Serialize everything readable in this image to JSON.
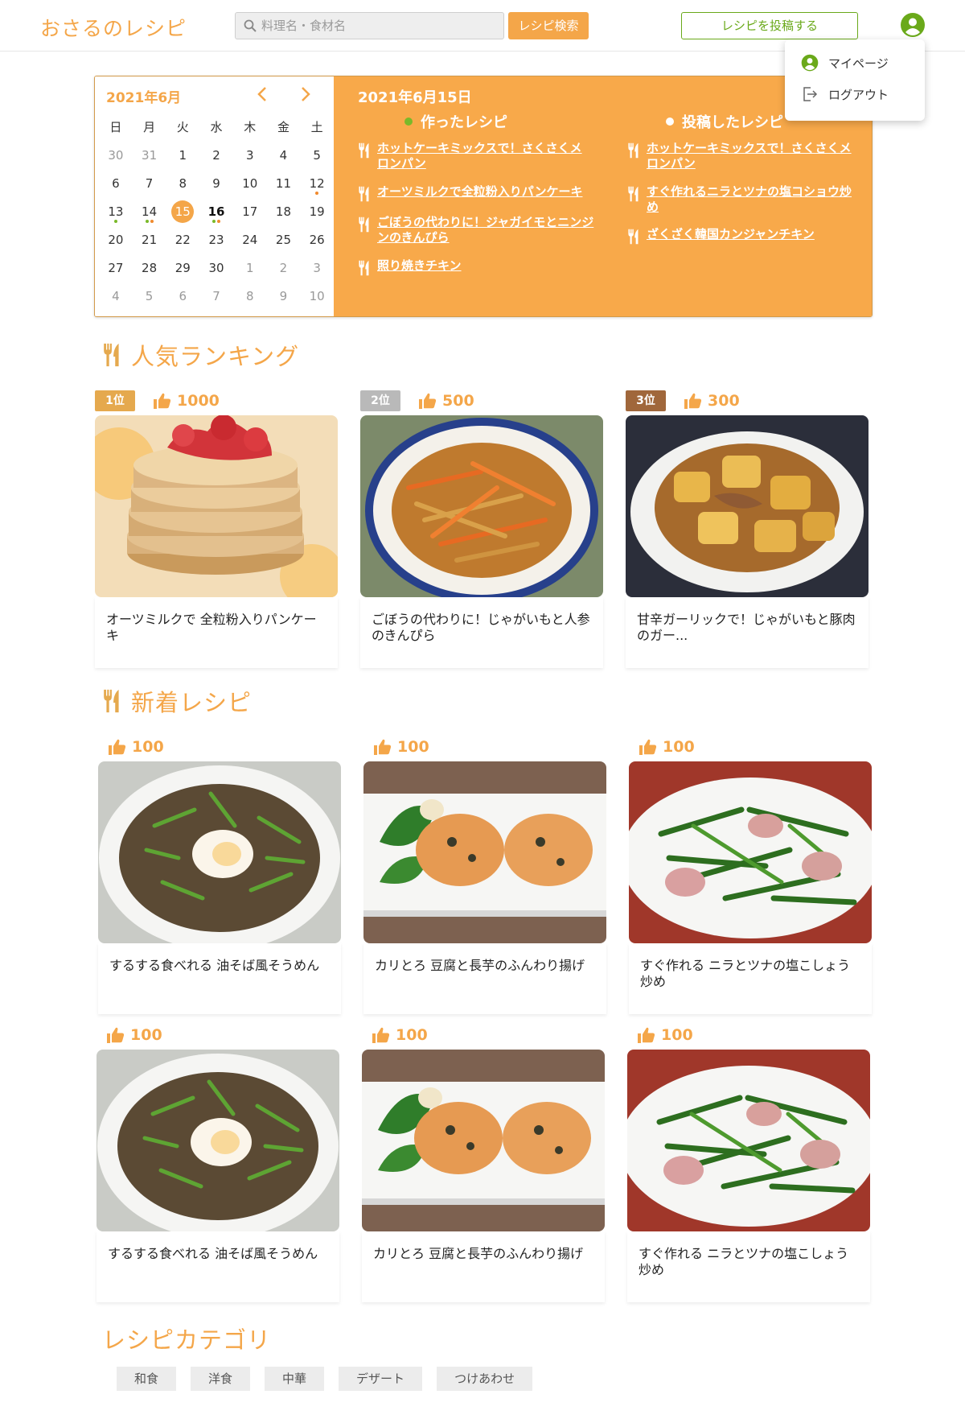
{
  "header": {
    "logo": "おさるのレシピ",
    "search_placeholder": "料理名・食材名",
    "search_button": "レシピ検索",
    "post_button": "レシピを投稿する",
    "avatar_icon": "user-circle-icon"
  },
  "dropdown": {
    "items": [
      {
        "label": "マイページ",
        "icon": "user-circle-icon"
      },
      {
        "label": "ログアウト",
        "icon": "logout-icon"
      }
    ]
  },
  "calendar": {
    "title": "2021年6月",
    "weekdays": [
      "日",
      "月",
      "火",
      "水",
      "木",
      "金",
      "土"
    ],
    "weeks": [
      [
        "30",
        "31",
        "1",
        "2",
        "3",
        "4",
        "5"
      ],
      [
        "6",
        "7",
        "8",
        "9",
        "10",
        "11",
        "12"
      ],
      [
        "13",
        "14",
        "15",
        "16",
        "17",
        "18",
        "19"
      ],
      [
        "20",
        "21",
        "22",
        "23",
        "24",
        "25",
        "26"
      ],
      [
        "27",
        "28",
        "29",
        "30",
        "1",
        "2",
        "3"
      ],
      [
        "4",
        "5",
        "6",
        "7",
        "8",
        "9",
        "10"
      ]
    ],
    "selected_day": "15",
    "bold_day": "16"
  },
  "day_panel": {
    "date": "2021年6月15日",
    "made_heading": "作ったレシピ",
    "posted_heading": "投稿したレシピ",
    "made_recipes": [
      "ホットケーキミックスで！さくさくメロンパン",
      "オーツミルクで全粒粉入りパンケーキ",
      "ごぼうの代わりに！ジャガイモとニンジンのきんぴら",
      "照り焼きチキン"
    ],
    "posted_recipes": [
      "ホットケーキミックスで！さくさくメロンパン",
      "すぐ作れるニラとツナの塩コショウ炒め",
      "ざくざく韓国カンジャンチキン"
    ],
    "made_color": "#7ab929",
    "posted_color": "#ffffff"
  },
  "ranking": {
    "title": "人気ランキング",
    "items": [
      {
        "rank": "1位",
        "likes": "1000",
        "name": "オーツミルクで 全粒粉入りパンケーキ",
        "badge_color": "#e5a94e"
      },
      {
        "rank": "2位",
        "likes": "500",
        "name": "ごぼうの代わりに！じゃがいもと人参のきんぴら",
        "badge_color": "#b9b9b9"
      },
      {
        "rank": "3位",
        "likes": "300",
        "name": "甘辛ガーリックで！じゃがいもと豚肉のガー...",
        "badge_color": "#a0673b"
      }
    ]
  },
  "new_recipes": {
    "title": "新着レシピ",
    "items": [
      {
        "likes": "100",
        "name": "するする食べれる 油そば風そうめん"
      },
      {
        "likes": "100",
        "name": "カリとろ 豆腐と長芋のふんわり揚げ"
      },
      {
        "likes": "100",
        "name": "すぐ作れる ニラとツナの塩こしょう炒め"
      },
      {
        "likes": "100",
        "name": "するする食べれる 油そば風そうめん"
      },
      {
        "likes": "100",
        "name": "カリとろ 豆腐と長芋のふんわり揚げ"
      },
      {
        "likes": "100",
        "name": "すぐ作れる ニラとツナの塩こしょう炒め"
      }
    ]
  },
  "categories": {
    "title": "レシピカテゴリ",
    "items": [
      "和食",
      "洋食",
      "中華",
      "デザート",
      "つけあわせ"
    ]
  },
  "colors": {
    "accent": "#f4a649",
    "green": "#6aa91a",
    "panel": "#f8a94a"
  }
}
